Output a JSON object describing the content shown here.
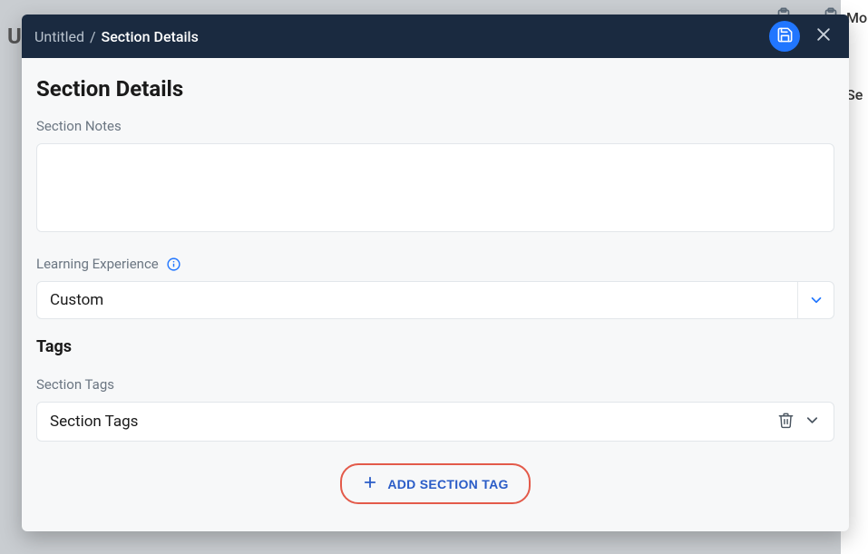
{
  "background": {
    "left_char": "U",
    "right_line1": "Mo",
    "right_line2": "Se"
  },
  "header": {
    "breadcrumb_root": "Untitled",
    "breadcrumb_separator": "/",
    "breadcrumb_current": "Section Details"
  },
  "body": {
    "title": "Section Details",
    "notes_label": "Section Notes",
    "notes_value": "",
    "learning_exp_label": "Learning Experience",
    "learning_exp_value": "Custom",
    "tags_heading": "Tags",
    "section_tags_label": "Section Tags",
    "section_tags_value": "Section Tags",
    "add_tag_button": "ADD SECTION TAG"
  }
}
